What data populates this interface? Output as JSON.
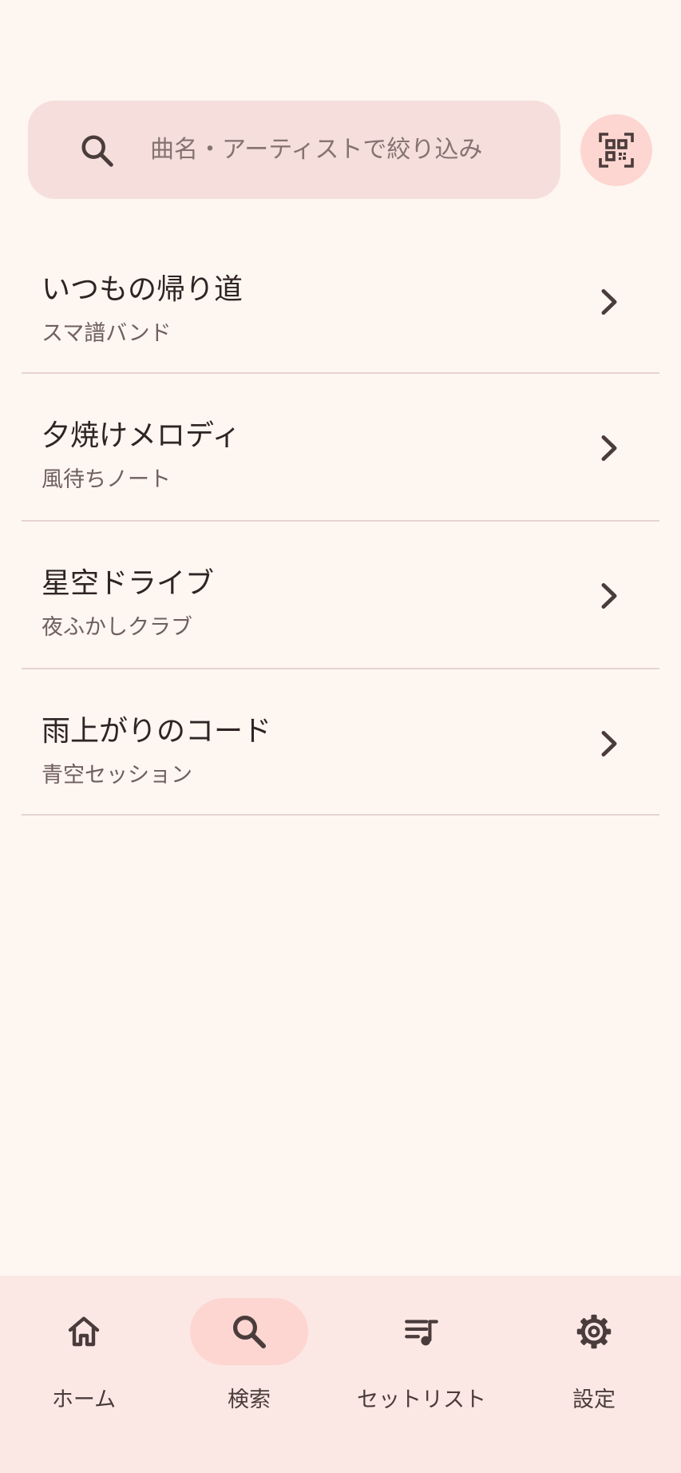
{
  "search": {
    "placeholder": "曲名・アーティストで絞り込み",
    "value": ""
  },
  "qr_button": {
    "icon": "qr-code-scan-icon"
  },
  "songs": [
    {
      "title": "いつもの帰り道",
      "artist": "スマ譜バンド"
    },
    {
      "title": "夕焼けメロディ",
      "artist": "風待ちノート"
    },
    {
      "title": "星空ドライブ",
      "artist": "夜ふかしクラブ"
    },
    {
      "title": "雨上がりのコード",
      "artist": "青空セッション"
    }
  ],
  "bottom_nav": {
    "items": [
      {
        "label": "ホーム",
        "icon": "home-icon",
        "active": false
      },
      {
        "label": "検索",
        "icon": "search-icon",
        "active": true
      },
      {
        "label": "セットリスト",
        "icon": "playlist-icon",
        "active": false
      },
      {
        "label": "設定",
        "icon": "gear-icon",
        "active": false
      }
    ]
  },
  "colors": {
    "background": "#FEF6F1",
    "search_bar": "#F5DEDB",
    "accent_pill": "#FDD6D1",
    "nav_background": "#FBE8E5",
    "divider": "#E6D4D0",
    "primary_text": "#2F2424",
    "secondary_text": "#6F5F5E"
  }
}
